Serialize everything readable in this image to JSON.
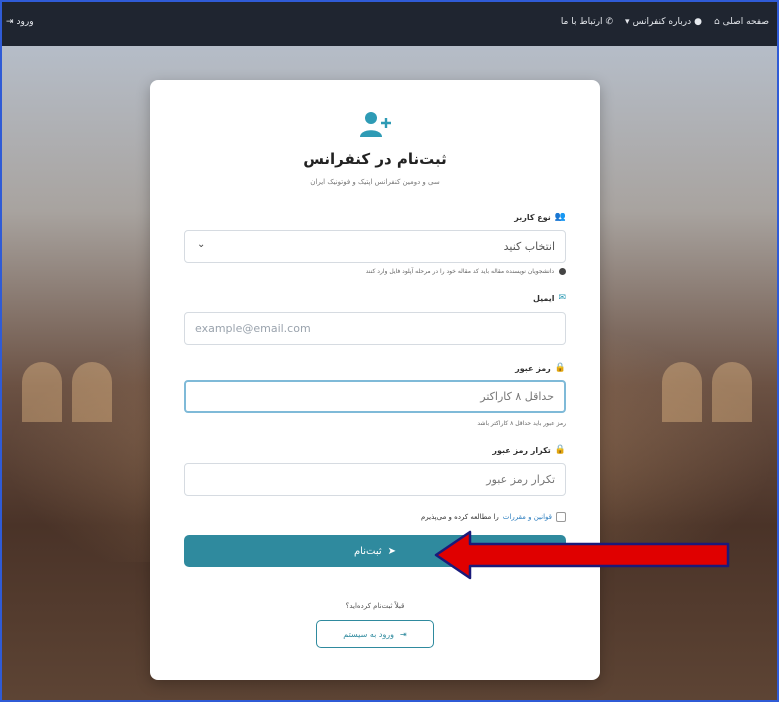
{
  "topbar": {
    "nav_home": "صفحه اصلی",
    "nav_about": "درباره کنفرانس",
    "nav_contact": "ارتباط با ما",
    "login_short": "ورود"
  },
  "card": {
    "icon": "user-plus-icon",
    "title": "ثبت‌نام در کنفرانس",
    "subtitle": "سی و دومین کنفرانس اپتیک و فوتونیک ایران"
  },
  "form": {
    "user_type": {
      "label": "نوع کاربر",
      "value": "انتخاب کنید",
      "hint": "دانشجویان نویسنده مقاله باید کد مقاله خود را در مرحله آپلود فایل وارد کنند"
    },
    "email": {
      "label": "ایمیل",
      "placeholder": "example@email.com"
    },
    "password": {
      "label": "رمز عبور",
      "placeholder": "حداقل ۸ کاراکتر",
      "hint": "رمز عبور باید حداقل ۸ کاراکتر باشد"
    },
    "password_confirm": {
      "label": "تکرار رمز عبور",
      "placeholder": "تکرار رمز عبور"
    },
    "terms": {
      "link": "قوانین و مقررات",
      "text": "را مطالعه کرده و می‌پذیرم"
    },
    "submit_label": "ثبت‌نام"
  },
  "footer": {
    "already": "قبلاً ثبت‌نام کرده‌اید؟",
    "login_label": "ورود به سیستم"
  },
  "colors": {
    "accent": "#2f8a9e",
    "annotation": "#e00000",
    "topbar": "#1f2530"
  }
}
